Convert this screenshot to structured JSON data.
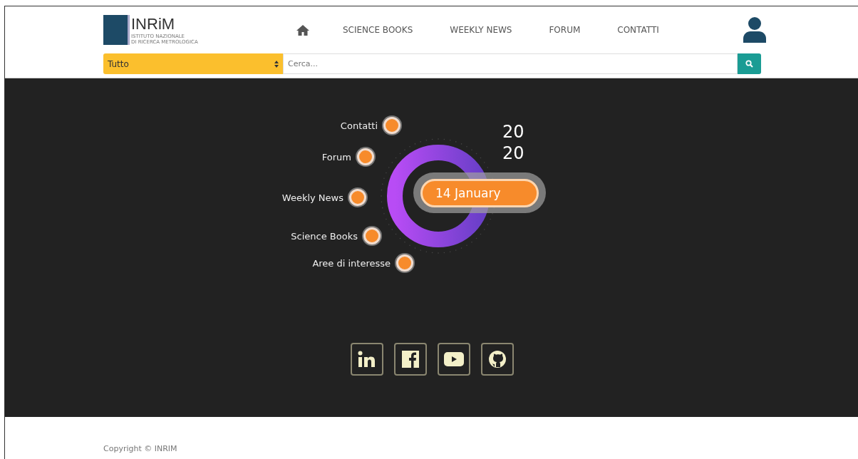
{
  "logo": {
    "name": "INRiM",
    "subtitle_lines": [
      "ISTITUTO NAZIONALE",
      "DI RICERCA METROLOGICA"
    ]
  },
  "nav": {
    "items": [
      "SCIENCE BOOKS",
      "WEEKLY NEWS",
      "FORUM",
      "CONTATTI"
    ]
  },
  "search": {
    "category": "Tutto",
    "placeholder": "Cerca..."
  },
  "circle_menu": {
    "items": [
      "Contatti",
      "Forum",
      "Weekly News",
      "Science Books",
      "Aree di interesse"
    ],
    "year_lines": [
      "20",
      "20"
    ],
    "date": "14 January"
  },
  "social": [
    {
      "kind": "linkedin"
    },
    {
      "kind": "facebook"
    },
    {
      "kind": "youtube"
    },
    {
      "kind": "github"
    }
  ],
  "footer": {
    "copyright": "Copyright © INRIM"
  }
}
